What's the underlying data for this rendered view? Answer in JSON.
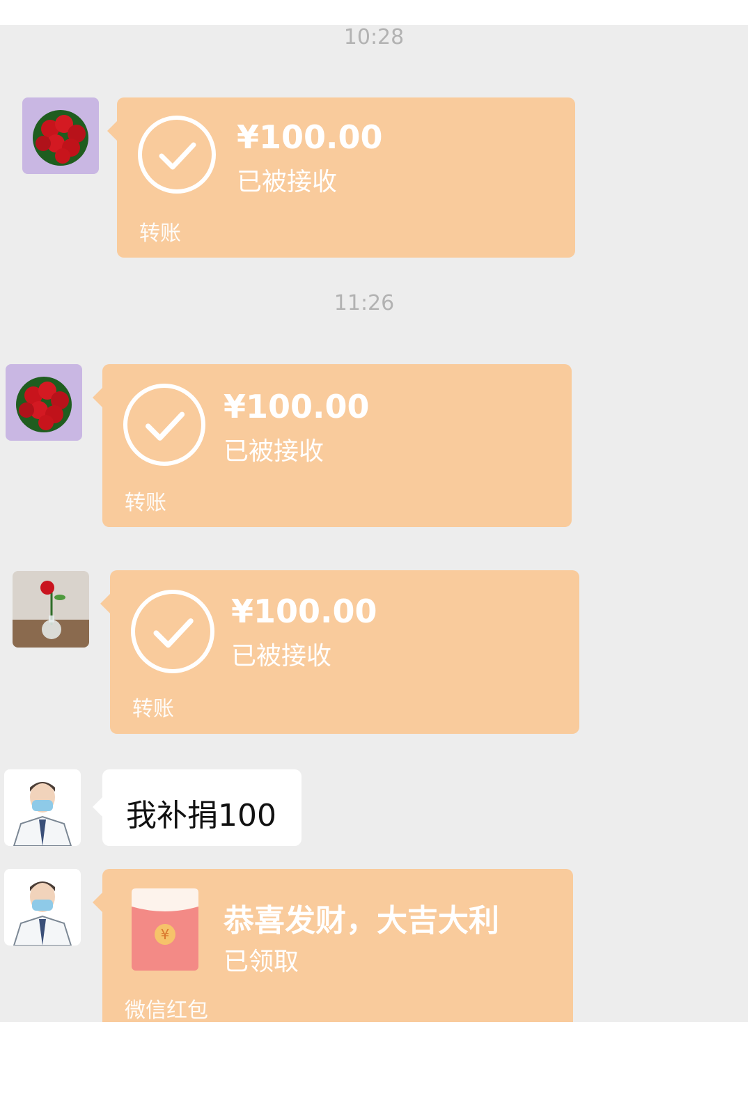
{
  "chat": {
    "timestamps": [
      "10:28",
      "11:26"
    ],
    "transfers": [
      {
        "amount": "¥100.00",
        "status": "已被接收",
        "label": "转账",
        "avatar_icon": "rose-bouquet-avatar"
      },
      {
        "amount": "¥100.00",
        "status": "已被接收",
        "label": "转账",
        "avatar_icon": "rose-bouquet-avatar"
      },
      {
        "amount": "¥100.00",
        "status": "已被接收",
        "label": "转账",
        "avatar_icon": "single-rose-vase-avatar"
      }
    ],
    "text_message": {
      "text": "我补捐100",
      "avatar_icon": "doctor-mask-avatar"
    },
    "red_packet": {
      "greeting": "恭喜发财，大吉大利",
      "status": "已领取",
      "label": "微信红包",
      "coin_glyph": "¥",
      "avatar_icon": "doctor-mask-avatar"
    }
  },
  "colors": {
    "background": "#ededed",
    "card": "#f9cb9c",
    "bubble": "#ffffff",
    "timestamp": "#b2b2b2",
    "envelope": "#f38a86"
  }
}
